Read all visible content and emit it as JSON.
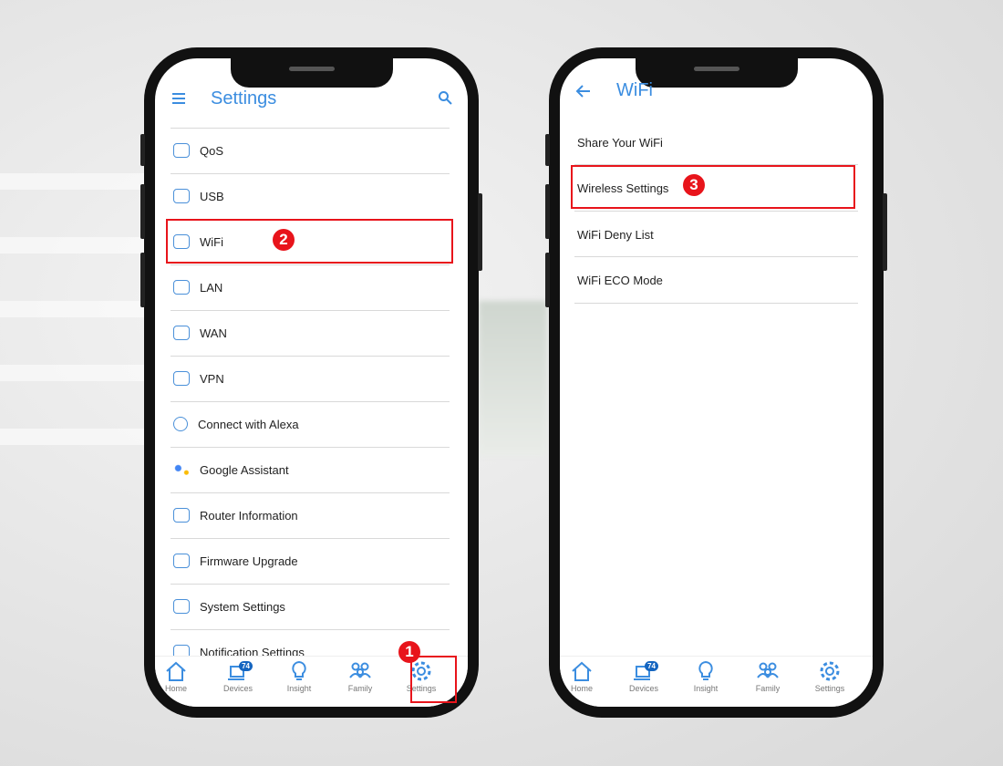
{
  "left_phone": {
    "title": "Settings",
    "menu_icon": "hamburger-icon",
    "search_icon": "search-icon",
    "items": [
      {
        "label": "QoS",
        "icon": "speedometer-icon"
      },
      {
        "label": "USB",
        "icon": "cloud-usb-icon"
      },
      {
        "label": "WiFi",
        "icon": "wifi-icon"
      },
      {
        "label": "LAN",
        "icon": "lan-icon"
      },
      {
        "label": "WAN",
        "icon": "wan-icon"
      },
      {
        "label": "VPN",
        "icon": "vpn-icon"
      },
      {
        "label": "Connect with Alexa",
        "icon": "alexa-icon"
      },
      {
        "label": "Google Assistant",
        "icon": "google-assistant-icon"
      },
      {
        "label": "Router Information",
        "icon": "router-info-icon"
      },
      {
        "label": "Firmware Upgrade",
        "icon": "firmware-icon"
      },
      {
        "label": "System Settings",
        "icon": "system-settings-icon"
      },
      {
        "label": "Notification Settings",
        "icon": "notification-icon"
      }
    ]
  },
  "right_phone": {
    "title": "WiFi",
    "back_icon": "back-arrow-icon",
    "items": [
      {
        "label": "Share Your WiFi"
      },
      {
        "label": "Wireless Settings"
      },
      {
        "label": "WiFi Deny List"
      },
      {
        "label": "WiFi ECO Mode"
      }
    ]
  },
  "tabbar": {
    "items": [
      {
        "label": "Home",
        "icon": "home-icon"
      },
      {
        "label": "Devices",
        "icon": "devices-icon",
        "badge": "74"
      },
      {
        "label": "Insight",
        "icon": "lightbulb-icon"
      },
      {
        "label": "Family",
        "icon": "family-icon"
      },
      {
        "label": "Settings",
        "icon": "gear-icon"
      }
    ]
  },
  "steps": [
    "1",
    "2",
    "3"
  ],
  "colors": {
    "accent": "#3b8de0",
    "highlight": "#e8141b",
    "badge": "#1565c0"
  }
}
